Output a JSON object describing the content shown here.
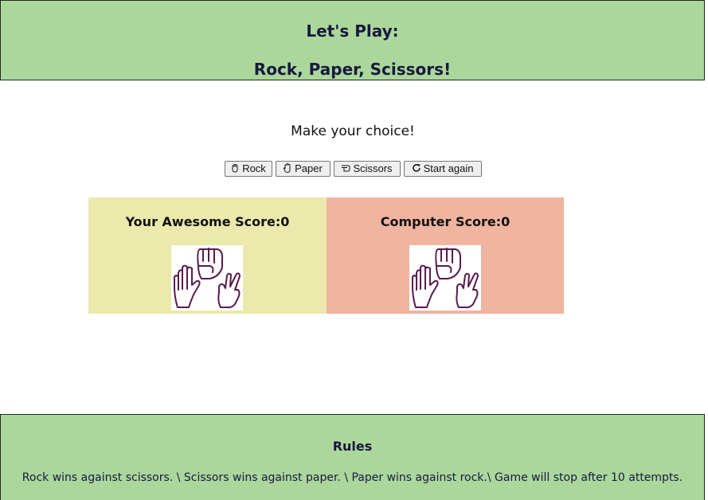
{
  "header": {
    "line1": "Let's Play:",
    "line2": "Rock, Paper, Scissors!"
  },
  "prompt": "Make your choice!",
  "buttons": [
    {
      "label": "Rock",
      "icon": "hand-fist-icon"
    },
    {
      "label": "Paper",
      "icon": "hand-paper-icon"
    },
    {
      "label": "Scissors",
      "icon": "hand-scissors-icon"
    },
    {
      "label": "Start again",
      "icon": "refresh-icon"
    }
  ],
  "scores": {
    "user_label": "Your Awesome Score:",
    "user_value": "0",
    "computer_label": "Computer Score:",
    "computer_value": "0"
  },
  "rules": {
    "title": "Rules",
    "text": "Rock wins against scissors. \\ Scissors wins against paper. \\ Paper wins against rock.\\ Game will stop after 10 attempts."
  },
  "colors": {
    "header_bg": "#acd79c",
    "user_panel": "#ebe9ac",
    "computer_panel": "#f0b4a0",
    "hand_outline": "#5a1a4e"
  }
}
